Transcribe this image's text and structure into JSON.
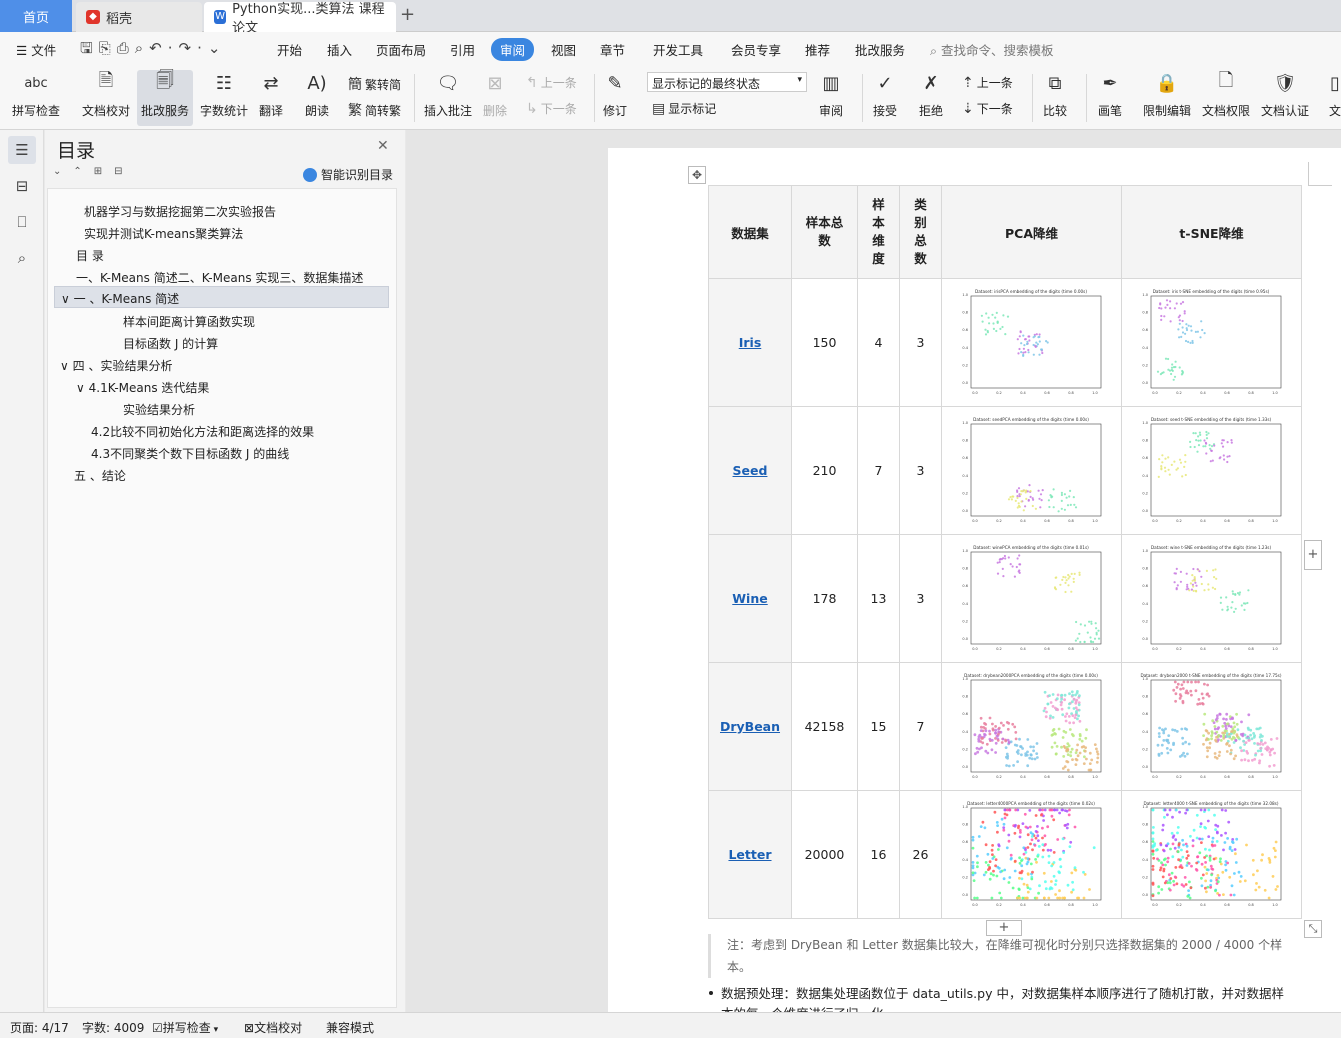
{
  "tabs": {
    "home": "首页",
    "daoke": "稻壳",
    "doc": "Python实现...类算法 课程论文",
    "add": "+"
  },
  "menu": {
    "file": "文件",
    "items": [
      "开始",
      "插入",
      "页面布局",
      "引用",
      "审阅",
      "视图",
      "章节",
      "开发工具",
      "会员专享",
      "推荐",
      "批改服务"
    ],
    "active": "审阅",
    "search": "查找命令、搜索模板"
  },
  "toolbar": {
    "spell": "拼写检查",
    "doccheck": "文档校对",
    "correct": "批改服务",
    "wordcount": "字数统计",
    "translate": "翻译",
    "read": "朗读",
    "trad": "繁转简",
    "simp": "简转繁",
    "insert_comment": "插入批注",
    "delete": "删除",
    "prev_comment": "上一条",
    "next_comment": "下一条",
    "revise": "修订",
    "markup_state": "显示标记的最终状态",
    "show_markup": "显示标记",
    "review": "审阅",
    "accept": "接受",
    "reject": "拒绝",
    "prev": "上一条",
    "next": "下一条",
    "compare": "比较",
    "pen": "画笔",
    "restrict": "限制编辑",
    "perm": "文档权限",
    "cert": "文档认证",
    "more": "文"
  },
  "toc": {
    "title": "目录",
    "smart": "智能识别目录",
    "items": [
      {
        "text": "机器学习与数据挖掘第二次实验报告",
        "indent": 0
      },
      {
        "text": "实现并测试K-means聚类算法",
        "indent": 0
      },
      {
        "text": "目 录",
        "indent": 1
      },
      {
        "text": "一、K-Means 简述二、K-Means 实现三、数据集描述",
        "indent": 1
      },
      {
        "text": "一 、K-Means 简述",
        "indent": 1,
        "selected": true,
        "toggle": "∨"
      },
      {
        "text": "样本间距离计算函数实现",
        "indent": 3
      },
      {
        "text": "目标函数 J 的计算",
        "indent": 3
      },
      {
        "text": "四 、实验结果分析",
        "indent": 1,
        "toggle": "∨"
      },
      {
        "text": "4.1K-Means 迭代结果",
        "indent": 2,
        "toggle": "∨"
      },
      {
        "text": "实验结果分析",
        "indent": 3
      },
      {
        "text": "4.2比较不同初始化方法和距离选择的效果",
        "indent": 2
      },
      {
        "text": "4.3不同聚类个数下目标函数 J 的曲线",
        "indent": 2
      },
      {
        "text": "五 、结论",
        "indent": 1
      }
    ]
  },
  "table": {
    "headers": [
      "数据集",
      "样本总数",
      "样本维度",
      "类别总数",
      "PCA降维",
      "t-SNE降维"
    ],
    "rows": [
      {
        "name": "Iris",
        "n": "150",
        "dim": "4",
        "k": "3",
        "pca_title": "Dataset: irisPCA embedding of the digits (time 0.00s)",
        "tsne_title": "Dataset: iris t-SNE embedding of the digits (time 0.95s)"
      },
      {
        "name": "Seed",
        "n": "210",
        "dim": "7",
        "k": "3",
        "pca_title": "Dataset: seedPCA embedding of the digits (time 0.00s)",
        "tsne_title": "Dataset: seed t-SNE embedding of the digits (time 1.33s)"
      },
      {
        "name": "Wine",
        "n": "178",
        "dim": "13",
        "k": "3",
        "pca_title": "Dataset: winePCA embedding of the digits (time 0.01s)",
        "tsne_title": "Dataset: wine t-SNE embedding of the digits (time 1.23s)"
      },
      {
        "name": "DryBean",
        "n": "42158",
        "dim": "15",
        "k": "7",
        "pca_title": "Dataset: drybean2000PCA embedding of the digits (time 0.00s)",
        "tsne_title": "Dataset: drybean2000 t-SNE embedding of the digits (time 17.75s)"
      },
      {
        "name": "Letter",
        "n": "20000",
        "dim": "16",
        "k": "26",
        "pca_title": "Dataset: letter4000PCA embedding of the digits (time 0.02s)",
        "tsne_title": "Dataset: letter4000 t-SNE embedding of the digits (time 32.08s)"
      }
    ]
  },
  "plot_axis": {
    "ticks": [
      "0.0",
      "0.2",
      "0.4",
      "0.6",
      "0.8",
      "1.0"
    ]
  },
  "note": "注：考虑到 DryBean 和 Letter 数据集比较大，在降维可视化时分别只选择数据集的 2000 / 4000 个样本。",
  "bullet": "数据预处理：数据集处理函数位于 data_utils.py 中，对数据集样本顺序进行了随机打散，并对数据样本的每一个维度进行了归一化",
  "status": {
    "page": "页面: 4/17",
    "words": "字数: 4009",
    "spell": "拼写检查",
    "doccheck": "文档校对",
    "compat": "兼容模式"
  },
  "colors": {
    "accent": "#3a86e0",
    "link": "#1a5fb4"
  }
}
